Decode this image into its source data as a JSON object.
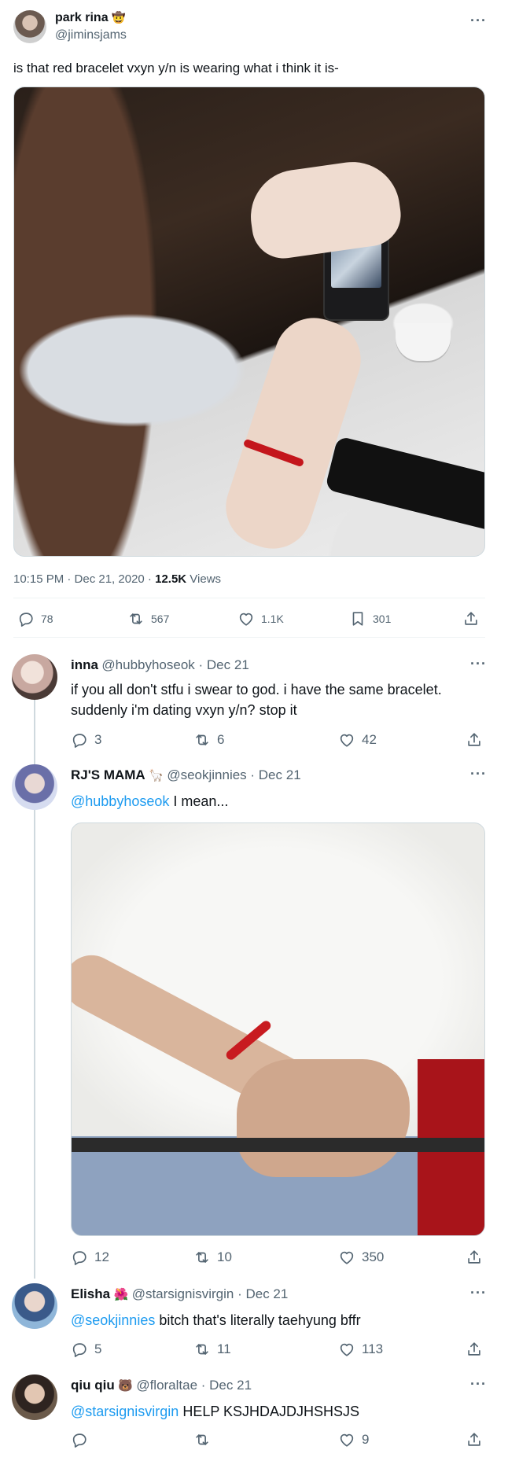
{
  "main": {
    "name": "park rina",
    "emoji": "🤠",
    "handle": "@jiminsjams",
    "text": "is that red bracelet vxyn y/n is wearing what i think it is-",
    "meta_time": "10:15 PM · Dec 21, 2020 · ",
    "views_count": "12.5K",
    "views_label": " Views",
    "replies": "78",
    "retweets": "567",
    "likes": "1.1K",
    "bookmarks": "301"
  },
  "replies": [
    {
      "name": "inna",
      "emoji": "",
      "handle": "@hubbyhoseok · Dec 21",
      "text_line1": "if you all don't stfu i swear to god. i have the same bracelet.",
      "text_line2": "suddenly i'm dating vxyn y/n? stop it",
      "replies": "3",
      "retweets": "6",
      "likes": "42"
    },
    {
      "name": "RJ'S MAMA",
      "emoji": "🦙",
      "handle": "@seokjinnies · Dec 21",
      "mention": "@hubbyhoseok",
      "text": " I mean...",
      "replies": "12",
      "retweets": "10",
      "likes": "350"
    },
    {
      "name": "Elisha",
      "emoji": "🌺",
      "handle": "@starsignisvirgin · Dec 21",
      "mention": "@seokjinnies",
      "text": " bitch that's literally taehyung bffr",
      "replies": "5",
      "retweets": "11",
      "likes": "113"
    },
    {
      "name": "qiu qiu",
      "emoji": "🐻",
      "handle": "@floraltae · Dec 21",
      "mention": "@starsignisvirgin",
      "text": " HELP KSJHDAJDJHSHSJS",
      "replies": "",
      "retweets": "",
      "likes": "9"
    }
  ],
  "icons": {
    "more": "more-icon",
    "reply": "reply-icon",
    "retweet": "retweet-icon",
    "like": "heart-icon",
    "bookmark": "bookmark-icon",
    "share": "share-icon"
  },
  "colors": {
    "accent": "#1d9bf0",
    "secondary_text": "#536471",
    "divider": "#eff3f4"
  }
}
